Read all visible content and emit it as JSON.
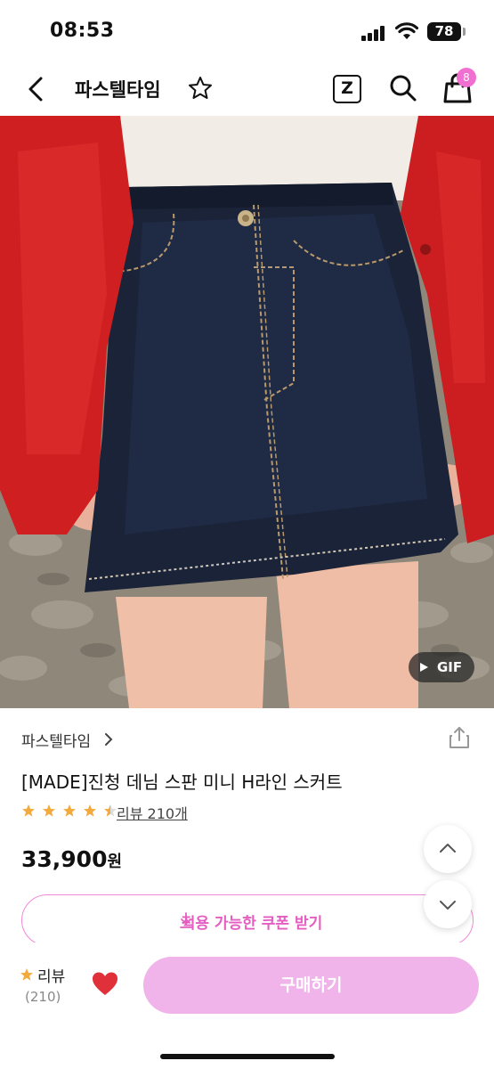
{
  "status_bar": {
    "time": "08:53",
    "battery": "78"
  },
  "nav": {
    "title": "파스텔타임",
    "cart_badge": "8",
    "z_label": "Z"
  },
  "product": {
    "gif_label": "GIF",
    "brand": "파스텔타임",
    "title": "[MADE]진청 데님 스판 미니 H라인 스커트",
    "rating": 4.5,
    "review_link": "리뷰 210개",
    "price_number": "33,900",
    "price_unit": "원"
  },
  "coupon": {
    "label": "적용 가능한 쿠폰 받기"
  },
  "bottom": {
    "review_label": "리뷰",
    "review_count": "(210)",
    "buy_label": "구매하기"
  },
  "colors": {
    "accent": "#f06fd0",
    "buy_button": "#f0b3ea",
    "star": "#f3a93b",
    "heart": "#e0303a"
  }
}
